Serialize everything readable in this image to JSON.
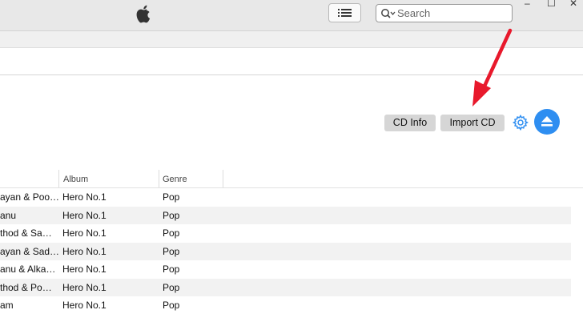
{
  "window": {
    "controls": {
      "minimize": "–",
      "maximize": "☐",
      "close": "✕"
    }
  },
  "toolbar": {
    "search_placeholder": "Search"
  },
  "cd_actions": {
    "cd_info_label": "CD Info",
    "import_cd_label": "Import CD"
  },
  "colors": {
    "accent": "#2e8ef1",
    "annotation_arrow": "#e8192c"
  },
  "table": {
    "columns": [
      "Album",
      "Genre"
    ],
    "rows": [
      {
        "artist": "ayan & Poo…",
        "album": "Hero No.1",
        "genre": "Pop"
      },
      {
        "artist": "anu",
        "album": "Hero No.1",
        "genre": "Pop"
      },
      {
        "artist": "thod & Sa…",
        "album": "Hero No.1",
        "genre": "Pop"
      },
      {
        "artist": "ayan & Sad…",
        "album": "Hero No.1",
        "genre": "Pop"
      },
      {
        "artist": "anu & Alka…",
        "album": "Hero No.1",
        "genre": "Pop"
      },
      {
        "artist": "thod & Po…",
        "album": "Hero No.1",
        "genre": "Pop"
      },
      {
        "artist": "am",
        "album": "Hero No.1",
        "genre": "Pop"
      }
    ]
  }
}
